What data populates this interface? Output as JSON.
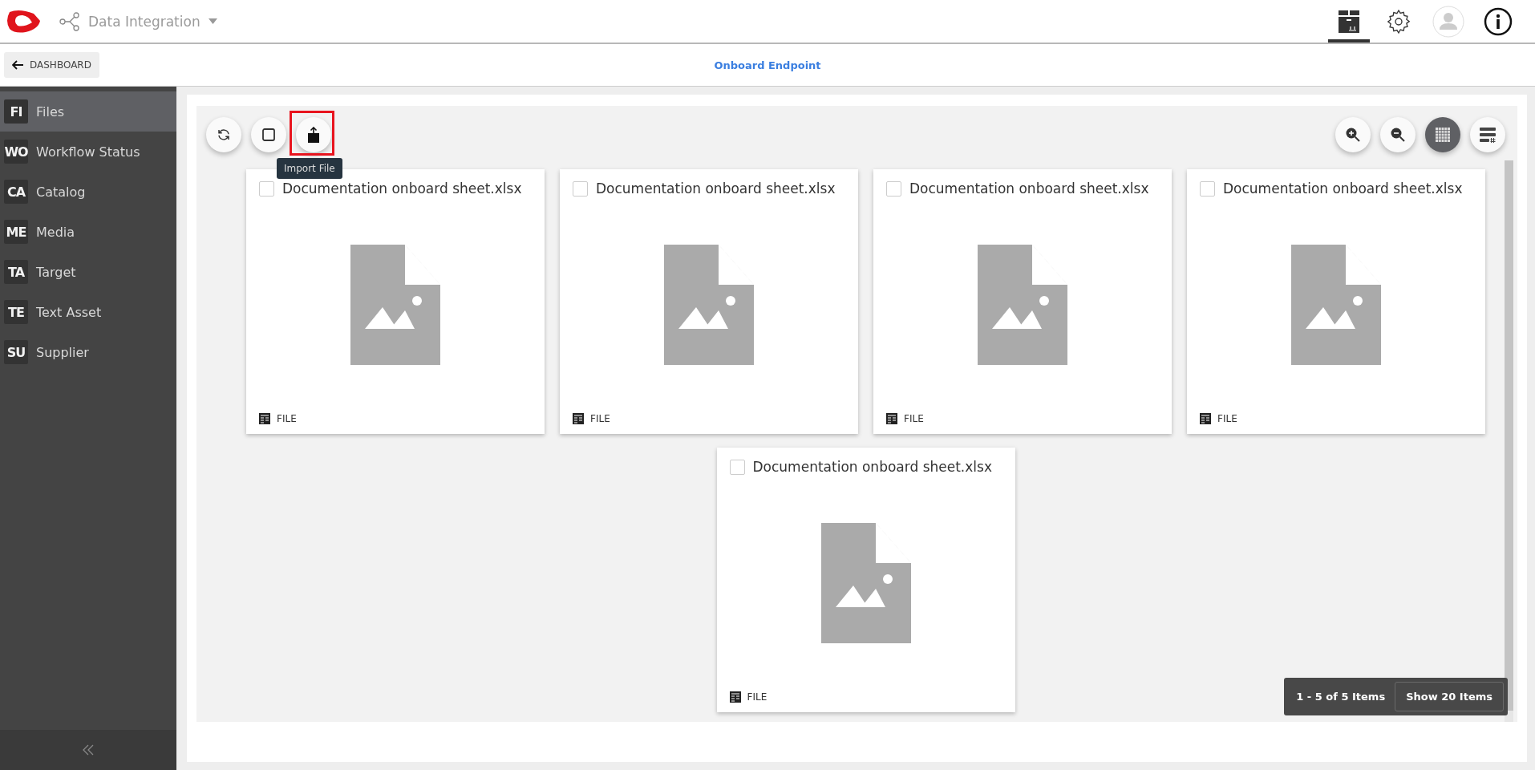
{
  "header": {
    "app_title": "Data Integration",
    "icons": [
      {
        "kind": "box",
        "selected": true
      },
      {
        "kind": "settings",
        "selected": false
      },
      {
        "kind": "avatar",
        "selected": false
      },
      {
        "kind": "info",
        "selected": false
      }
    ]
  },
  "subbar": {
    "back_label": "DASHBOARD",
    "title": "Onboard Endpoint"
  },
  "sidebar": {
    "items": [
      {
        "abbr": "FI",
        "label": "Files",
        "selected": true
      },
      {
        "abbr": "WO",
        "label": "Workflow Status",
        "selected": false
      },
      {
        "abbr": "CA",
        "label": "Catalog",
        "selected": false
      },
      {
        "abbr": "ME",
        "label": "Media",
        "selected": false
      },
      {
        "abbr": "TA",
        "label": "Target",
        "selected": false
      },
      {
        "abbr": "TE",
        "label": "Text Asset",
        "selected": false
      },
      {
        "abbr": "SU",
        "label": "Supplier",
        "selected": false
      }
    ]
  },
  "toolbar": {
    "left": [
      {
        "kind": "refresh",
        "highlighted": false
      },
      {
        "kind": "select",
        "highlighted": false
      },
      {
        "kind": "import",
        "highlighted": true
      }
    ],
    "tooltip": "Import File",
    "right": [
      {
        "kind": "zoom_in",
        "selected": false
      },
      {
        "kind": "zoom_out",
        "selected": false
      },
      {
        "kind": "grid",
        "selected": true
      },
      {
        "kind": "list",
        "selected": false
      }
    ]
  },
  "cards": [
    {
      "title": "Documentation onboard sheet.xlsx",
      "checked": false,
      "type": "FILE"
    },
    {
      "title": "Documentation onboard sheet.xlsx",
      "checked": false,
      "type": "FILE"
    },
    {
      "title": "Documentation onboard sheet.xlsx",
      "checked": false,
      "type": "FILE"
    },
    {
      "title": "Documentation onboard sheet.xlsx",
      "checked": false,
      "type": "FILE"
    },
    {
      "title": "Documentation onboard sheet.xlsx",
      "checked": false,
      "type": "FILE"
    }
  ],
  "pagination": {
    "summary": "1 - 5 of 5 Items",
    "button": "Show 20 Items"
  }
}
